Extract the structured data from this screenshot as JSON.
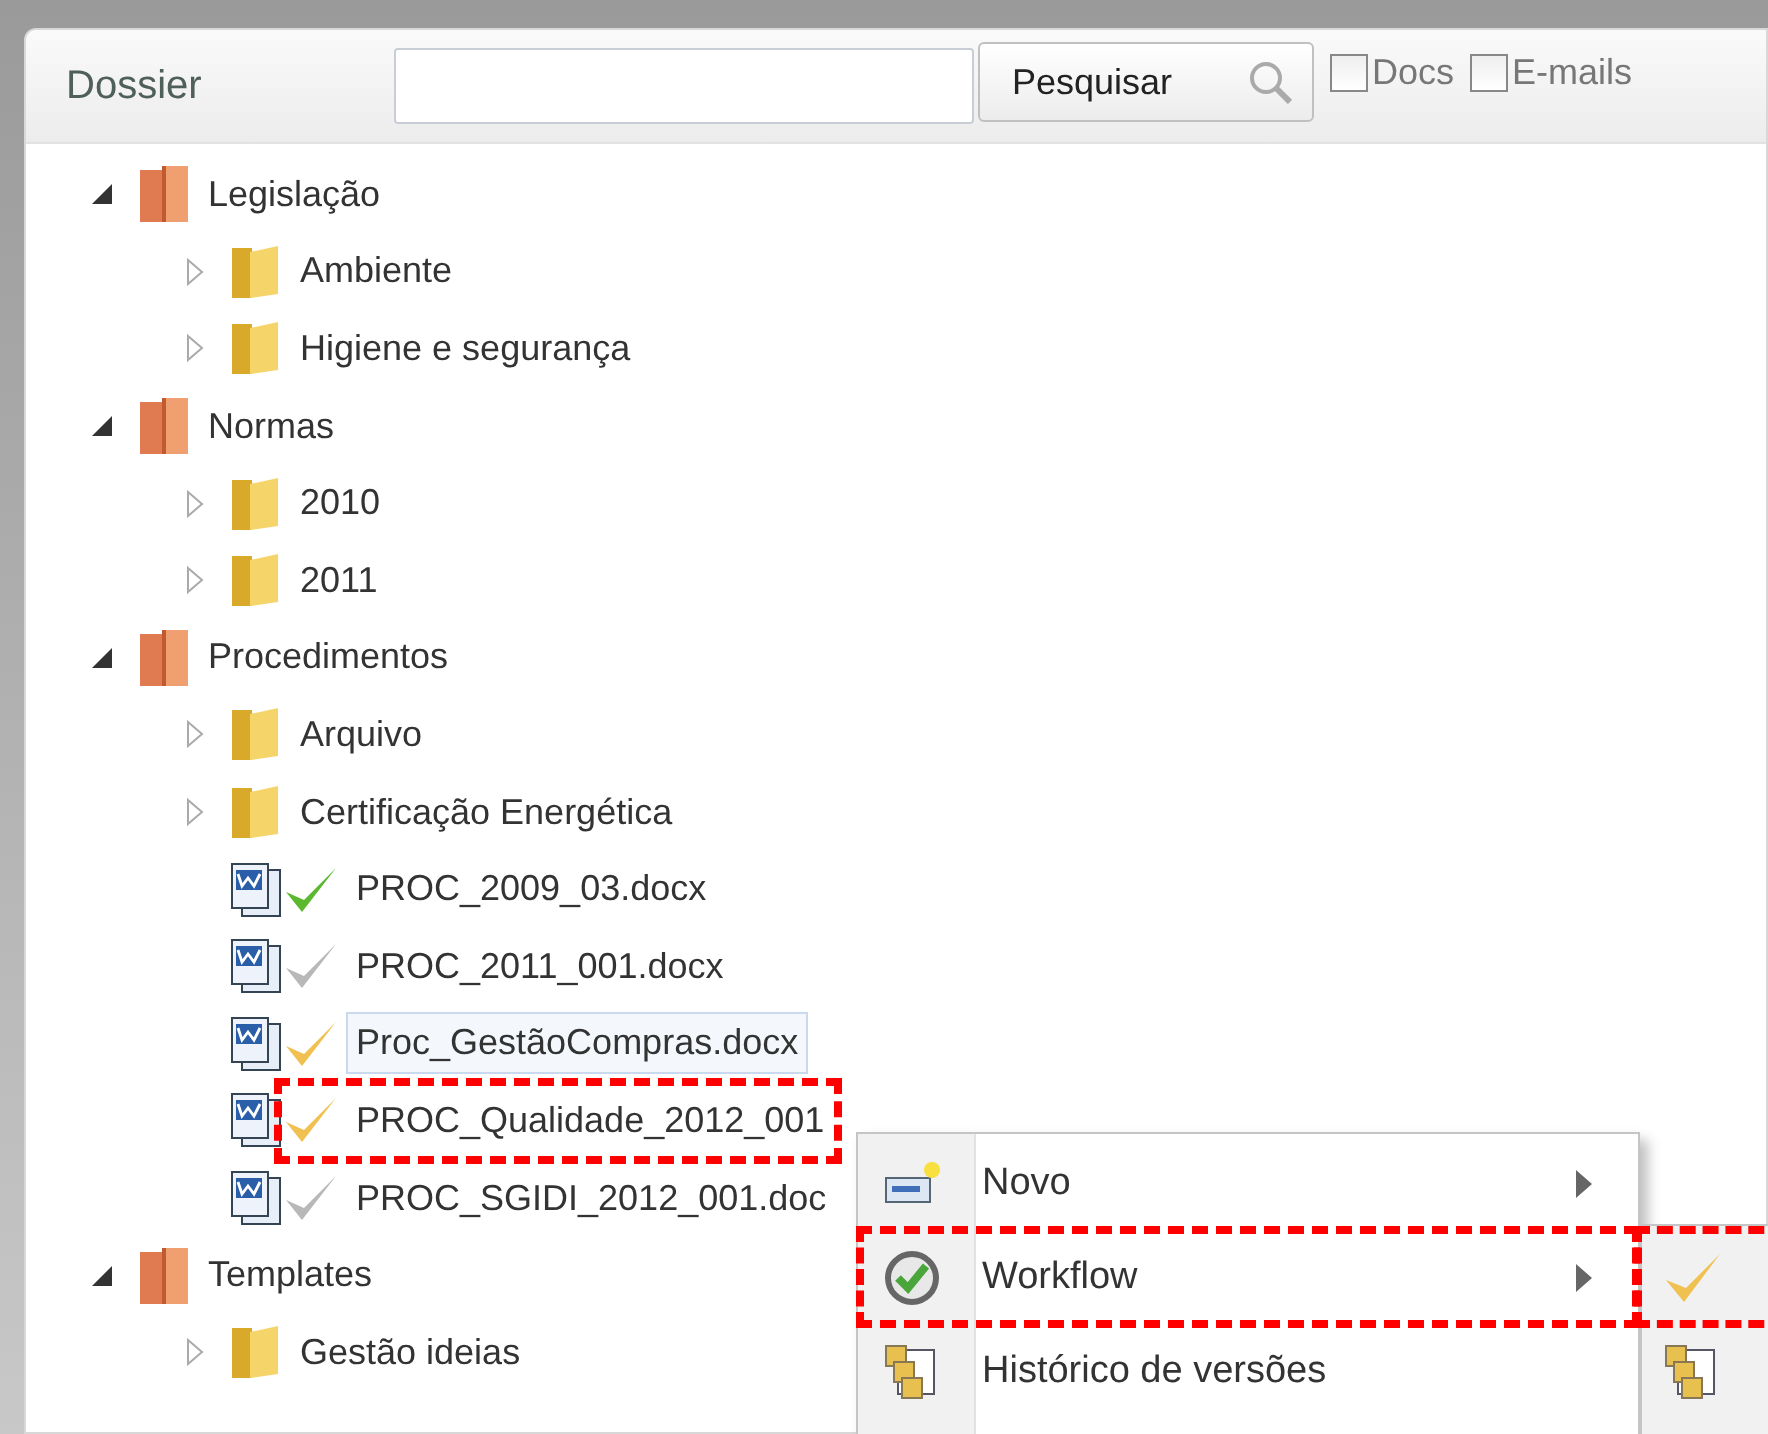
{
  "panel": {
    "title": "Dossier",
    "search": {
      "button": "Pesquisar"
    },
    "filters": [
      {
        "label": "Docs",
        "checked": false
      },
      {
        "label": "E-mails",
        "checked": false
      }
    ]
  },
  "tree": [
    {
      "kind": "cabinet",
      "label": "Legislação",
      "expanded": true,
      "children": [
        {
          "kind": "folder",
          "label": "Ambiente",
          "expanded": false
        },
        {
          "kind": "folder",
          "label": "Higiene e segurança",
          "expanded": false
        }
      ]
    },
    {
      "kind": "cabinet",
      "label": "Normas",
      "expanded": true,
      "children": [
        {
          "kind": "folder",
          "label": "2010",
          "expanded": false
        },
        {
          "kind": "folder",
          "label": "2011",
          "expanded": false
        }
      ]
    },
    {
      "kind": "cabinet",
      "label": "Procedimentos",
      "expanded": true,
      "children": [
        {
          "kind": "folder",
          "label": "Arquivo",
          "expanded": false
        },
        {
          "kind": "folder",
          "label": "Certificação Energética",
          "expanded": false
        },
        {
          "kind": "file",
          "label": "PROC_2009_03.docx",
          "color": "#5cb82e",
          "selected": false,
          "highlighted": false
        },
        {
          "kind": "file",
          "label": "PROC_2011_001.docx",
          "color": "#b8b8b8",
          "selected": false,
          "highlighted": false
        },
        {
          "kind": "file",
          "label": "Proc_GestãoCompras.docx",
          "color": "#f0c050",
          "selected": true,
          "highlighted": false
        },
        {
          "kind": "file",
          "label": "PROC_Qualidade_2012_001",
          "color": "#f0c050",
          "selected": false,
          "highlighted": true
        },
        {
          "kind": "file",
          "label": "PROC_SGIDI_2012_001.doc",
          "color": "#b8b8b8",
          "selected": false,
          "highlighted": false
        }
      ]
    },
    {
      "kind": "cabinet",
      "label": "Templates",
      "expanded": true,
      "children": [
        {
          "kind": "folder",
          "label": "Gestão ideias",
          "expanded": false
        }
      ]
    }
  ],
  "context_menu": {
    "items": [
      {
        "kind": "new",
        "label": "Novo",
        "submenu": true,
        "highlighted": false
      },
      {
        "kind": "workflow",
        "label": "Workflow",
        "submenu": true,
        "highlighted": true
      },
      {
        "kind": "history",
        "label": "Histórico de versões",
        "submenu": false,
        "highlighted": false
      }
    ],
    "submenu": {
      "items": [
        {
          "kind": "check",
          "highlighted": true
        },
        {
          "kind": "history",
          "highlighted": false
        }
      ]
    }
  }
}
